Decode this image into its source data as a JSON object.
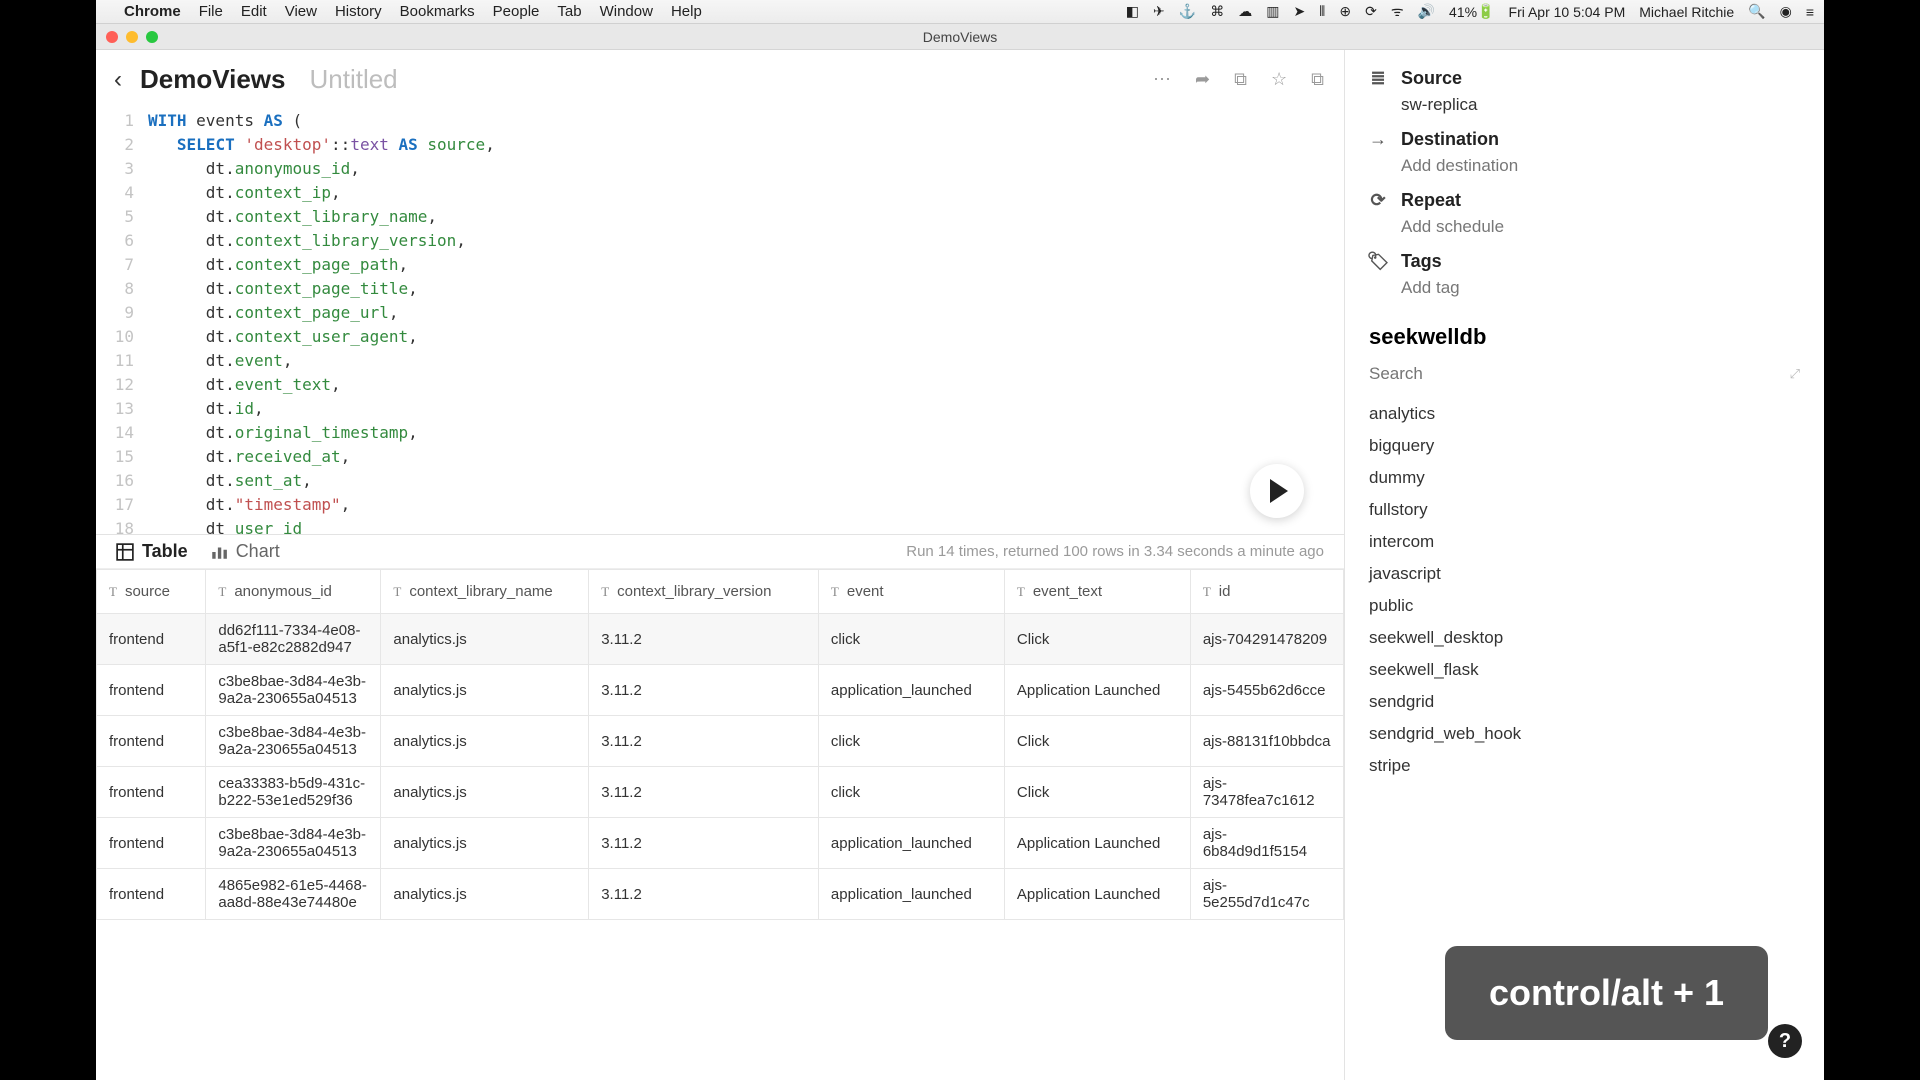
{
  "menubar": {
    "apple": "",
    "app": "Chrome",
    "items": [
      "File",
      "Edit",
      "View",
      "History",
      "Bookmarks",
      "People",
      "Tab",
      "Window",
      "Help"
    ],
    "battery": "41%",
    "datetime": "Fri Apr 10  5:04 PM",
    "user": "Michael Ritchie"
  },
  "window": {
    "title": "DemoViews"
  },
  "header": {
    "brand": "DemoViews",
    "doc_title": "Untitled"
  },
  "editor": {
    "lines": [
      {
        "n": "1",
        "segs": [
          {
            "t": "WITH",
            "c": "kw"
          },
          {
            "t": " events ",
            "c": ""
          },
          {
            "t": "AS",
            "c": "kw"
          },
          {
            "t": " (",
            "c": ""
          }
        ]
      },
      {
        "n": "2",
        "segs": [
          {
            "t": "   ",
            "c": ""
          },
          {
            "t": "SELECT",
            "c": "kw"
          },
          {
            "t": " ",
            "c": ""
          },
          {
            "t": "'desktop'",
            "c": "str"
          },
          {
            "t": "::",
            "c": ""
          },
          {
            "t": "text",
            "c": "typ"
          },
          {
            "t": " ",
            "c": ""
          },
          {
            "t": "AS",
            "c": "kw"
          },
          {
            "t": " ",
            "c": ""
          },
          {
            "t": "source",
            "c": "col"
          },
          {
            "t": ",",
            "c": ""
          }
        ]
      },
      {
        "n": "3",
        "segs": [
          {
            "t": "      dt.",
            "c": ""
          },
          {
            "t": "anonymous_id",
            "c": "col"
          },
          {
            "t": ",",
            "c": ""
          }
        ]
      },
      {
        "n": "4",
        "segs": [
          {
            "t": "      dt.",
            "c": ""
          },
          {
            "t": "context_ip",
            "c": "col"
          },
          {
            "t": ",",
            "c": ""
          }
        ]
      },
      {
        "n": "5",
        "segs": [
          {
            "t": "      dt.",
            "c": ""
          },
          {
            "t": "context_library_name",
            "c": "col"
          },
          {
            "t": ",",
            "c": ""
          }
        ]
      },
      {
        "n": "6",
        "segs": [
          {
            "t": "      dt.",
            "c": ""
          },
          {
            "t": "context_library_version",
            "c": "col"
          },
          {
            "t": ",",
            "c": ""
          }
        ]
      },
      {
        "n": "7",
        "segs": [
          {
            "t": "      dt.",
            "c": ""
          },
          {
            "t": "context_page_path",
            "c": "col"
          },
          {
            "t": ",",
            "c": ""
          }
        ]
      },
      {
        "n": "8",
        "segs": [
          {
            "t": "      dt.",
            "c": ""
          },
          {
            "t": "context_page_title",
            "c": "col"
          },
          {
            "t": ",",
            "c": ""
          }
        ]
      },
      {
        "n": "9",
        "segs": [
          {
            "t": "      dt.",
            "c": ""
          },
          {
            "t": "context_page_url",
            "c": "col"
          },
          {
            "t": ",",
            "c": ""
          }
        ]
      },
      {
        "n": "10",
        "segs": [
          {
            "t": "      dt.",
            "c": ""
          },
          {
            "t": "context_user_agent",
            "c": "col"
          },
          {
            "t": ",",
            "c": ""
          }
        ]
      },
      {
        "n": "11",
        "segs": [
          {
            "t": "      dt.",
            "c": ""
          },
          {
            "t": "event",
            "c": "col"
          },
          {
            "t": ",",
            "c": ""
          }
        ]
      },
      {
        "n": "12",
        "segs": [
          {
            "t": "      dt.",
            "c": ""
          },
          {
            "t": "event_text",
            "c": "col"
          },
          {
            "t": ",",
            "c": ""
          }
        ]
      },
      {
        "n": "13",
        "segs": [
          {
            "t": "      dt.",
            "c": ""
          },
          {
            "t": "id",
            "c": "col"
          },
          {
            "t": ",",
            "c": ""
          }
        ]
      },
      {
        "n": "14",
        "segs": [
          {
            "t": "      dt.",
            "c": ""
          },
          {
            "t": "original_timestamp",
            "c": "col"
          },
          {
            "t": ",",
            "c": ""
          }
        ]
      },
      {
        "n": "15",
        "segs": [
          {
            "t": "      dt.",
            "c": ""
          },
          {
            "t": "received_at",
            "c": "col"
          },
          {
            "t": ",",
            "c": ""
          }
        ]
      },
      {
        "n": "16",
        "segs": [
          {
            "t": "      dt.",
            "c": ""
          },
          {
            "t": "sent_at",
            "c": "col"
          },
          {
            "t": ",",
            "c": ""
          }
        ]
      },
      {
        "n": "17",
        "segs": [
          {
            "t": "      dt.",
            "c": ""
          },
          {
            "t": "\"timestamp\"",
            "c": "str"
          },
          {
            "t": ",",
            "c": ""
          }
        ]
      },
      {
        "n": "18",
        "segs": [
          {
            "t": "      dt ",
            "c": ""
          },
          {
            "t": "user_id",
            "c": "col"
          }
        ]
      }
    ]
  },
  "tabs": {
    "table": "Table",
    "chart": "Chart",
    "status": "Run 14 times, returned 100 rows in 3.34 seconds a minute ago"
  },
  "table": {
    "columns": [
      "source",
      "anonymous_id",
      "context_library_name",
      "context_library_version",
      "event",
      "event_text",
      "id"
    ],
    "rows": [
      {
        "source": "frontend",
        "anonymous_id": "dd62f111-7334-4e08-a5f1-e82c2882d947",
        "context_library_name": "analytics.js",
        "context_library_version": "3.11.2",
        "event": "click",
        "event_text": "Click",
        "id": "ajs-704291478209"
      },
      {
        "source": "frontend",
        "anonymous_id": "c3be8bae-3d84-4e3b-9a2a-230655a04513",
        "context_library_name": "analytics.js",
        "context_library_version": "3.11.2",
        "event": "application_launched",
        "event_text": "Application Launched",
        "id": "ajs-5455b62d6cce"
      },
      {
        "source": "frontend",
        "anonymous_id": "c3be8bae-3d84-4e3b-9a2a-230655a04513",
        "context_library_name": "analytics.js",
        "context_library_version": "3.11.2",
        "event": "click",
        "event_text": "Click",
        "id": "ajs-88131f10bbdca"
      },
      {
        "source": "frontend",
        "anonymous_id": "cea33383-b5d9-431c-b222-53e1ed529f36",
        "context_library_name": "analytics.js",
        "context_library_version": "3.11.2",
        "event": "click",
        "event_text": "Click",
        "id": "ajs-73478fea7c1612"
      },
      {
        "source": "frontend",
        "anonymous_id": "c3be8bae-3d84-4e3b-9a2a-230655a04513",
        "context_library_name": "analytics.js",
        "context_library_version": "3.11.2",
        "event": "application_launched",
        "event_text": "Application Launched",
        "id": "ajs-6b84d9d1f5154"
      },
      {
        "source": "frontend",
        "anonymous_id": "4865e982-61e5-4468-aa8d-88e43e74480e",
        "context_library_name": "analytics.js",
        "context_library_version": "3.11.2",
        "event": "application_launched",
        "event_text": "Application Launched",
        "id": "ajs-5e255d7d1c47c"
      }
    ]
  },
  "sidebar": {
    "source_label": "Source",
    "source_value": "sw-replica",
    "dest_label": "Destination",
    "dest_value": "Add destination",
    "repeat_label": "Repeat",
    "repeat_value": "Add schedule",
    "tags_label": "Tags",
    "tags_value": "Add tag",
    "db_name": "seekwelldb",
    "search_placeholder": "Search",
    "schemas": [
      "analytics",
      "bigquery",
      "dummy",
      "fullstory",
      "intercom",
      "javascript",
      "public",
      "seekwell_desktop",
      "seekwell_flask",
      "sendgrid",
      "sendgrid_web_hook",
      "stripe"
    ]
  },
  "tooltip": "control/alt + 1"
}
